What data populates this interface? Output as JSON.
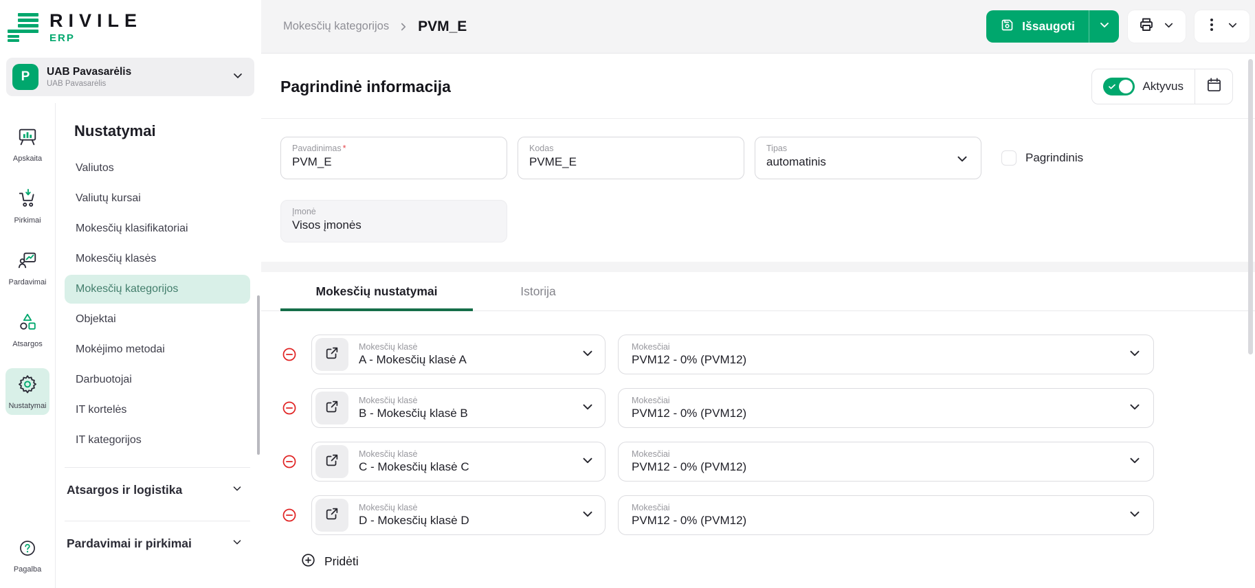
{
  "colors": {
    "accent": "#00a76d",
    "accent-dark": "#156e49",
    "danger": "#e02323",
    "selected-bg": "#d9f0e8",
    "selected-text": "#437e6c",
    "header-bg": "#f4f4f5"
  },
  "brand": {
    "name": "RIVILE",
    "product": "ERP"
  },
  "company": {
    "initial": "P",
    "name": "UAB Pavasarėlis",
    "subtitle": "UAB Pavasarėlis"
  },
  "nav_rail": {
    "items": [
      {
        "label": "Apskaita",
        "icon": "chart-board-icon",
        "active": false
      },
      {
        "label": "Pirkimai",
        "icon": "cart-icon",
        "active": false
      },
      {
        "label": "Pardavimai",
        "icon": "sales-chart-icon",
        "active": false
      },
      {
        "label": "Atsargos",
        "icon": "shapes-icon",
        "active": false
      },
      {
        "label": "Nustatymai",
        "icon": "gear-icon",
        "active": true
      }
    ],
    "help_label": "Pagalba"
  },
  "sidebar": {
    "title": "Nustatymai",
    "items": [
      "Valiutos",
      "Valiutų kursai",
      "Mokesčių klasifikatoriai",
      "Mokesčių klasės",
      "Mokesčių kategorijos",
      "Objektai",
      "Mokėjimo metodai",
      "Darbuotojai",
      "IT kortelės",
      "IT kategorijos"
    ],
    "active_item": "Mokesčių kategorijos",
    "groups": [
      "Atsargos ir logistika",
      "Pardavimai ir pirkimai"
    ]
  },
  "topbar": {
    "breadcrumb_parent": "Mokesčių kategorijos",
    "breadcrumb_current": "PVM_E",
    "save_label": "Išsaugoti"
  },
  "main": {
    "section_title": "Pagrindinė informacija",
    "active_label": "Aktyvus",
    "fields": {
      "pavadinimas": {
        "label": "Pavadinimas",
        "required_mark": "*",
        "value": "PVM_E"
      },
      "kodas": {
        "label": "Kodas",
        "value": "PVME_E"
      },
      "tipas": {
        "label": "Tipas",
        "value": "automatinis"
      },
      "pagrindinis": {
        "label": "Pagrindinis",
        "checked": false
      },
      "imone": {
        "label": "Įmonė",
        "value": "Visos įmonės",
        "disabled": true
      }
    },
    "tabs": [
      {
        "label": "Mokesčių nustatymai",
        "active": true
      },
      {
        "label": "Istorija",
        "active": false
      }
    ],
    "rows": [
      {
        "class_label": "Mokesčių klasė",
        "class_value": "A - Mokesčių klasė A",
        "tax_label": "Mokesčiai",
        "tax_value": "PVM12 - 0% (PVM12)"
      },
      {
        "class_label": "Mokesčių klasė",
        "class_value": "B - Mokesčių klasė B",
        "tax_label": "Mokesčiai",
        "tax_value": "PVM12 - 0% (PVM12)"
      },
      {
        "class_label": "Mokesčių klasė",
        "class_value": "C - Mokesčių klasė C",
        "tax_label": "Mokesčiai",
        "tax_value": "PVM12 - 0% (PVM12)"
      },
      {
        "class_label": "Mokesčių klasė",
        "class_value": "D - Mokesčių klasė D",
        "tax_label": "Mokesčiai",
        "tax_value": "PVM12 - 0% (PVM12)"
      }
    ],
    "add_label": "Pridėti"
  }
}
